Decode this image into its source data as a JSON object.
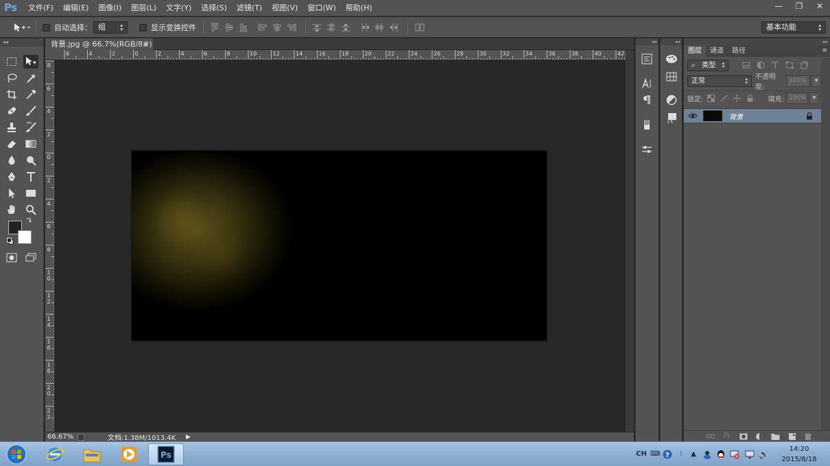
{
  "app": {
    "logo": "Ps"
  },
  "menu": [
    "文件(F)",
    "编辑(E)",
    "图像(I)",
    "图层(L)",
    "文字(Y)",
    "选择(S)",
    "滤镜(T)",
    "视图(V)",
    "窗口(W)",
    "帮助(H)"
  ],
  "window_controls": {
    "minimize": "—",
    "restore": "❐",
    "close": "✕"
  },
  "options": {
    "auto_select_label": "自动选择：",
    "auto_select_value": "组",
    "show_transform_label": "显示变换控件",
    "workspace": "基本功能"
  },
  "document": {
    "tab_title": "背景.jpg @ 66.7%(RGB/8#)",
    "close_glyph": "×",
    "zoom": "66.67%",
    "doc_size": "文档:1.38M/1013.4K"
  },
  "ruler": {
    "top": [
      "6",
      "4",
      "2",
      "0",
      "2",
      "4",
      "6",
      "8",
      "10",
      "12",
      "14",
      "16",
      "18",
      "20",
      "22",
      "24",
      "26",
      "28",
      "30",
      "32",
      "34",
      "36",
      "38",
      "40",
      "42"
    ],
    "left": [
      "8",
      "6",
      "4",
      "2",
      "0",
      "2",
      "4",
      "6",
      "8",
      "10",
      "12",
      "14",
      "16",
      "18",
      "20",
      "22"
    ]
  },
  "layers_panel": {
    "tabs": [
      "图层",
      "通道",
      "路径"
    ],
    "filter_kind": "类型",
    "blend_mode": "正常",
    "opacity_label": "不透明度:",
    "opacity_value": "100%",
    "lock_label": "锁定:",
    "fill_label": "填充:",
    "fill_value": "100%",
    "layer_name": "背景"
  },
  "taskbar": {
    "time": "14:20",
    "date": "2015/8/18",
    "lang": "CH"
  },
  "colors": {
    "ui_gray": "#535353",
    "workspace": "#282828",
    "selected_layer": "#6e8299",
    "ps_blue": "#6fa9dc"
  }
}
